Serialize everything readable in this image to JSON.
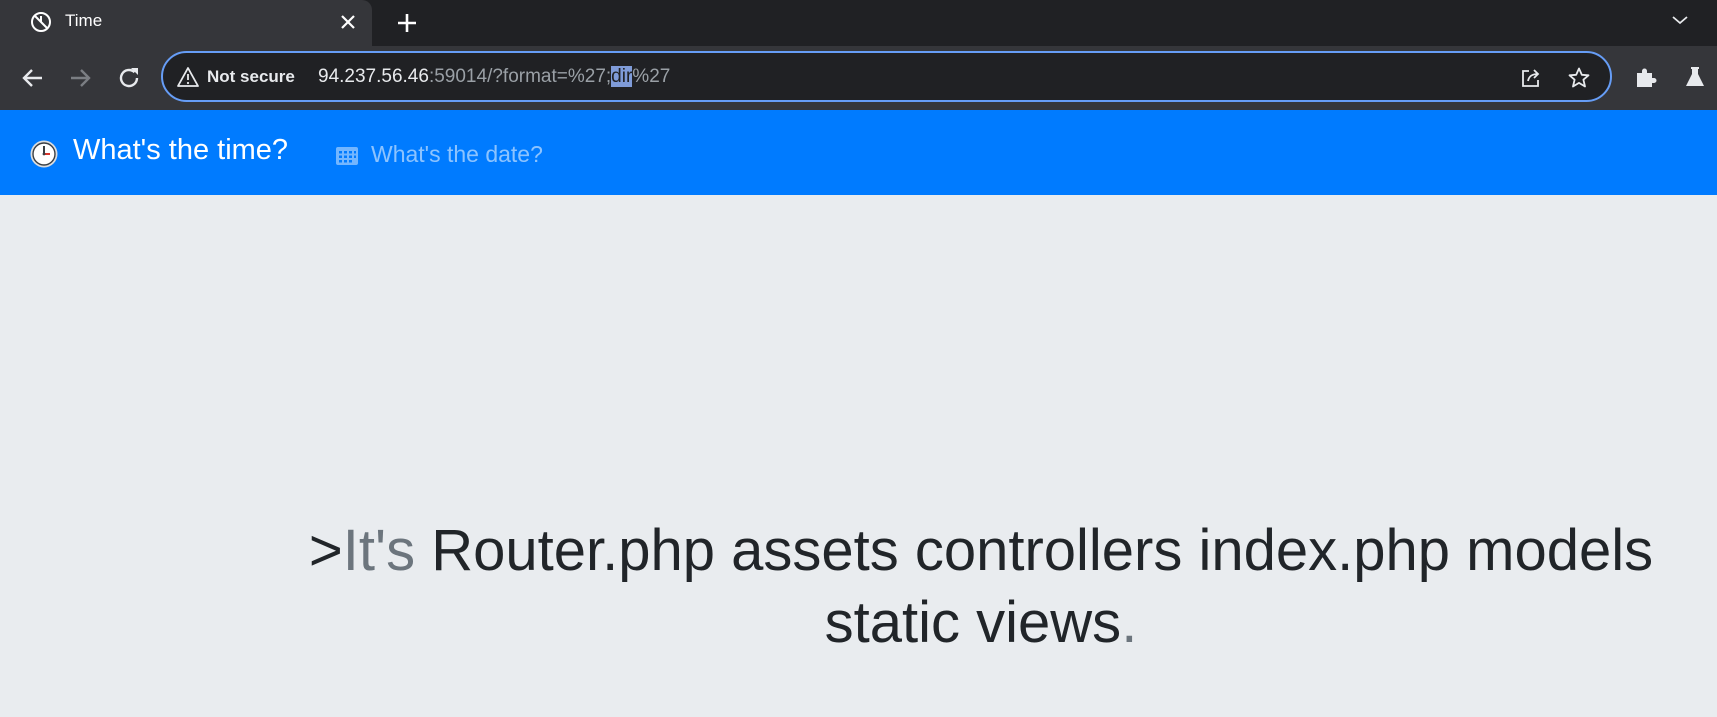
{
  "browser": {
    "tab_title": "Time",
    "omnibox": {
      "security_label": "Not secure",
      "url_host": "94.237.56.46",
      "url_rest_before": ":59014/?format=%27;",
      "url_selected": "dir",
      "url_rest_after": "%27"
    }
  },
  "navbar": {
    "brand": "What's the time?",
    "date_link": "What's the date?"
  },
  "main": {
    "prefix": ">",
    "muted_start": "It's",
    "message": " Router.php assets controllers index.php models static views",
    "muted_end": "."
  },
  "colors": {
    "navbar_bg": "#007bff",
    "page_bg": "#e9ecef",
    "chrome_bg": "#35363a",
    "tabstrip_bg": "#202124",
    "omnibox_focus": "#669df6"
  }
}
